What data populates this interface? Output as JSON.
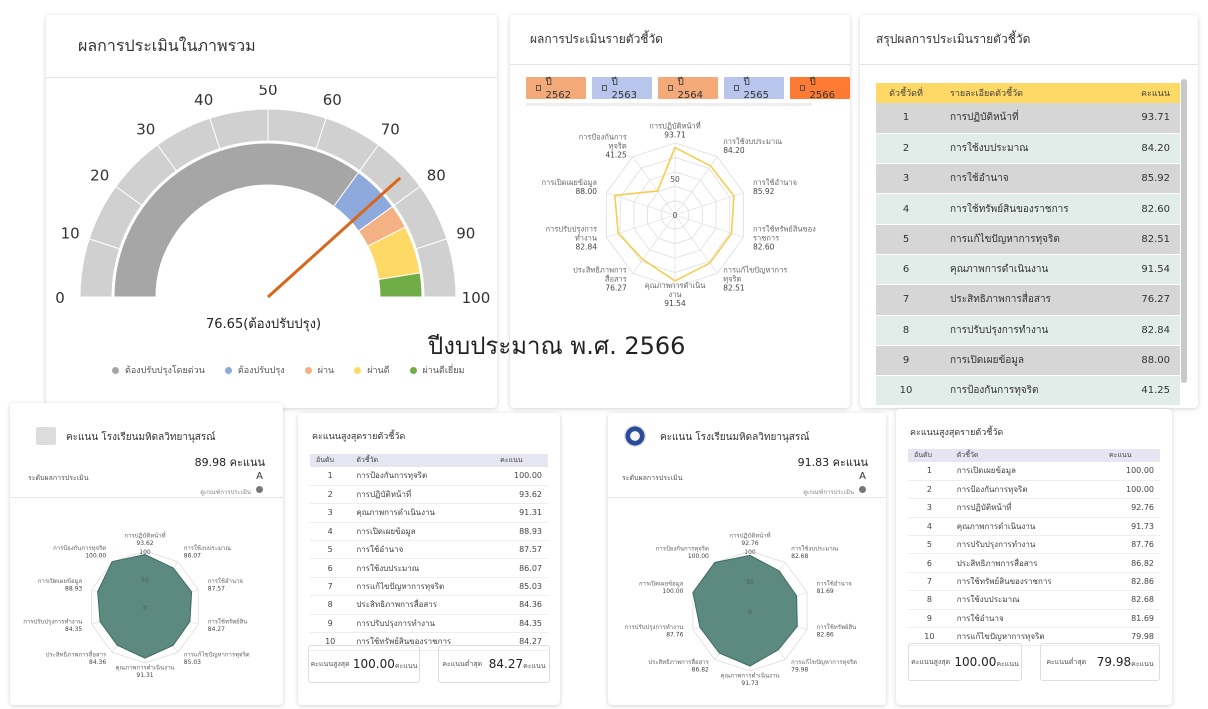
{
  "overlay_title": "ปีงบประมาณ พ.ศ. 2566",
  "overall": {
    "title": "ผลการประเมินในภาพรวม",
    "gauge_ticks": [
      "0",
      "10",
      "20",
      "30",
      "40",
      "50",
      "60",
      "70",
      "80",
      "90",
      "100"
    ],
    "value": 76.65,
    "caption": "76.65(ต้องปรับปรุง)",
    "legend": [
      {
        "label": "ต้องปรับปรุงโดยด่วน",
        "color": "#a6a6a6"
      },
      {
        "label": "ต้องปรับปรุง",
        "color": "#8ea9db"
      },
      {
        "label": "ผ่าน",
        "color": "#f4b183"
      },
      {
        "label": "ผ่านดี",
        "color": "#ffd966"
      },
      {
        "label": "ผ่านดีเยี่ยม",
        "color": "#70ad47"
      }
    ]
  },
  "indicator": {
    "title": "ผลการประเมินรายตัวชี้วัด",
    "years": [
      {
        "label": "ปี 2562",
        "color": "#f4a978"
      },
      {
        "label": "ปี 2563",
        "color": "#b8c5ec"
      },
      {
        "label": "ปี 2564",
        "color": "#f4a978"
      },
      {
        "label": "ปี 2565",
        "color": "#b8c5ec"
      },
      {
        "label": "ปี 2566",
        "color": "#ff7a33"
      }
    ],
    "radar_scale": [
      "0",
      "50"
    ],
    "labels": [
      "การปฏิบัติหน้าที่",
      "การใช้งบประมาณ",
      "การใช้อำนาจ",
      "การใช้ทรัพย์สินของ ราชการ",
      "การแก้ไขปัญหาการ ทุจริต",
      "คุณภาพการดำเนิน งาน",
      "ประสิทธิภาพการ สื่อสาร",
      "การปรับปรุงการ ทำงาน",
      "การเปิดเผยข้อมูล",
      "การป้องกันการ ทุจริต"
    ],
    "values": [
      "93.71",
      "84.20",
      "85.92",
      "82.60",
      "82.51",
      "91.54",
      "76.27",
      "82.84",
      "88.00",
      "41.25"
    ]
  },
  "summary": {
    "title": "สรุปผลการประเมินรายตัวชี้วัด",
    "headers": [
      "ตัวชี้วัดที่",
      "รายละเอียดตัวชี้วัด",
      "คะแนน"
    ],
    "rows": [
      [
        "1",
        "การปฏิบัติหน้าที่",
        "93.71"
      ],
      [
        "2",
        "การใช้งบประมาณ",
        "84.20"
      ],
      [
        "3",
        "การใช้อำนาจ",
        "85.92"
      ],
      [
        "4",
        "การใช้ทรัพย์สินของราชการ",
        "82.60"
      ],
      [
        "5",
        "การแก้ไขปัญหาการทุจริต",
        "82.51"
      ],
      [
        "6",
        "คุณภาพการดำเนินงาน",
        "91.54"
      ],
      [
        "7",
        "ประสิทธิภาพการสื่อสาร",
        "76.27"
      ],
      [
        "8",
        "การปรับปรุงการทำงาน",
        "82.84"
      ],
      [
        "9",
        "การเปิดเผยข้อมูล",
        "88.00"
      ],
      [
        "10",
        "การป้องกันการทุจริต",
        "41.25"
      ]
    ]
  },
  "school_a": {
    "title": "คะแนน โรงเรียนมหิดลวิทยานุสรณ์",
    "score": "89.98 คะแนน",
    "level_label": "ระดับผลการประเมิน",
    "level": "A",
    "criteria": "ดูเกณฑ์การประเมิน",
    "radar_scale": [
      "0",
      "50",
      "100"
    ],
    "labels": [
      "การปฏิบัติหน้าที่",
      "การใช้งบประมาณ",
      "การใช้อำนาจ",
      "การใช้ทรัพย์สิน",
      "การแก้ไขปัญหาการทุจริต",
      "คุณภาพการดำเนินงาน",
      "ประสิทธิภาพการสื่อสาร",
      "การปรับปรุงการทำงาน",
      "การเปิดเผยข้อมูล",
      "การป้องกันการทุจริต"
    ],
    "values": [
      "93.62",
      "86.07",
      "87.57",
      "84.27",
      "85.03",
      "91.31",
      "84.36",
      "84.35",
      "88.93",
      "100.00"
    ]
  },
  "top_a": {
    "title": "คะแนนสูงสุดรายตัวชี้วัด",
    "headers": [
      "อันดับ",
      "ตัวชี้วัด",
      "คะแนน"
    ],
    "rows": [
      [
        "1",
        "การป้องกันการทุจริต",
        "100.00"
      ],
      [
        "2",
        "การปฏิบัติหน้าที่",
        "93.62"
      ],
      [
        "3",
        "คุณภาพการดำเนินงาน",
        "91.31"
      ],
      [
        "4",
        "การเปิดเผยข้อมูล",
        "88.93"
      ],
      [
        "5",
        "การใช้อำนาจ",
        "87.57"
      ],
      [
        "6",
        "การใช้งบประมาณ",
        "86.07"
      ],
      [
        "7",
        "การแก้ไขปัญหาการทุจริต",
        "85.03"
      ],
      [
        "8",
        "ประสิทธิภาพการสื่อสาร",
        "84.36"
      ],
      [
        "9",
        "การปรับปรุงการทำงาน",
        "84.35"
      ],
      [
        "10",
        "การใช้ทรัพย์สินของราชการ",
        "84.27"
      ]
    ],
    "max_label": "คะแนนสูงสุด",
    "max_value": "100.00",
    "min_label": "คะแนนต่ำสุด",
    "min_value": "84.27",
    "unit": "คะแนน"
  },
  "school_b": {
    "title": "คะแนน โรงเรียนมหิดลวิทยานุสรณ์",
    "score": "91.83 คะแนน",
    "level_label": "ระดับผลการประเมิน",
    "level": "A",
    "criteria": "ดูเกณฑ์การประเมิน",
    "radar_scale": [
      "0",
      "50",
      "100"
    ],
    "labels": [
      "การปฏิบัติหน้าที่",
      "การใช้งบประมาณ",
      "การใช้อำนาจ",
      "การใช้ทรัพย์สิน",
      "การแก้ไขปัญหาการทุจริต",
      "คุณภาพการดำเนินงาน",
      "ประสิทธิภาพการสื่อสาร",
      "การปรับปรุงการทำงาน",
      "การเปิดเผยข้อมูล",
      "การป้องกันการทุจริต"
    ],
    "values": [
      "92.76",
      "82.68",
      "81.69",
      "82.86",
      "79.98",
      "91.73",
      "86.82",
      "87.76",
      "100.00",
      "100.00"
    ]
  },
  "top_b": {
    "title": "คะแนนสูงสุดรายตัวชี้วัด",
    "headers": [
      "อันดับ",
      "ตัวชี้วัด",
      "คะแนน"
    ],
    "rows": [
      [
        "1",
        "การเปิดเผยข้อมูล",
        "100.00"
      ],
      [
        "2",
        "การป้องกันการทุจริต",
        "100.00"
      ],
      [
        "3",
        "การปฏิบัติหน้าที่",
        "92.76"
      ],
      [
        "4",
        "คุณภาพการดำเนินงาน",
        "91.73"
      ],
      [
        "5",
        "การปรับปรุงการทำงาน",
        "87.76"
      ],
      [
        "6",
        "ประสิทธิภาพการสื่อสาร",
        "86.82"
      ],
      [
        "7",
        "การใช้ทรัพย์สินของราชการ",
        "82.86"
      ],
      [
        "8",
        "การใช้งบประมาณ",
        "82.68"
      ],
      [
        "9",
        "การใช้อำนาจ",
        "81.69"
      ],
      [
        "10",
        "การแก้ไขปัญหาการทุจริต",
        "79.98"
      ]
    ],
    "max_label": "คะแนนสูงสุด",
    "max_value": "100.00",
    "min_label": "คะแนนต่ำสุด",
    "min_value": "79.98",
    "unit": "คะแนน"
  }
}
